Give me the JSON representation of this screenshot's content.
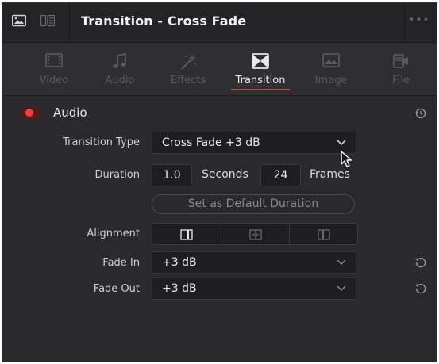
{
  "header": {
    "title": "Transition - Cross Fade",
    "left_icons": [
      "image-view-icon",
      "split-view-icon"
    ],
    "more_icon": "more-options-icon"
  },
  "tabs": [
    {
      "label": "Video",
      "icon": "video-icon",
      "active": false
    },
    {
      "label": "Audio",
      "icon": "music-note-icon",
      "active": false
    },
    {
      "label": "Effects",
      "icon": "magic-wand-icon",
      "active": false
    },
    {
      "label": "Transition",
      "icon": "transition-icon",
      "active": true
    },
    {
      "label": "Image",
      "icon": "image-icon",
      "active": false
    },
    {
      "label": "File",
      "icon": "file-icon",
      "active": false
    }
  ],
  "section": {
    "title": "Audio",
    "toggle_on": true,
    "accent": "#e0383e"
  },
  "transition_type": {
    "label": "Transition Type",
    "value": "Cross Fade +3 dB"
  },
  "duration": {
    "label": "Duration",
    "seconds_value": "1.0",
    "seconds_unit": "Seconds",
    "frames_value": "24",
    "frames_unit": "Frames"
  },
  "default_button": {
    "label": "Set as Default Duration"
  },
  "alignment": {
    "label": "Alignment",
    "options": [
      "align-end-icon",
      "align-center-icon",
      "align-start-icon"
    ],
    "selected_index": 0
  },
  "fade_in": {
    "label": "Fade In",
    "value": "+3 dB"
  },
  "fade_out": {
    "label": "Fade Out",
    "value": "+3 dB"
  }
}
